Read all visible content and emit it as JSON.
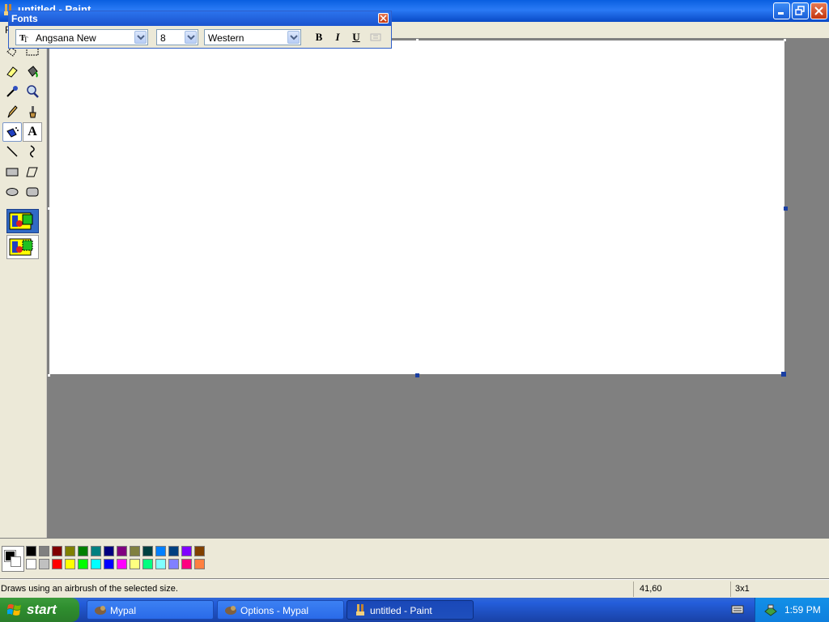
{
  "window": {
    "title": "untitled - Paint",
    "menu_first_letter": "F"
  },
  "fonts_toolbar": {
    "title": "Fonts",
    "font_name": "Angsana New",
    "font_size": "8",
    "script": "Western",
    "bold_label": "B",
    "italic_label": "I",
    "underline_label": "U"
  },
  "toolbox": {
    "tools": [
      "free-form-select-icon",
      "select-icon",
      "eraser-icon",
      "fill-with-color-icon",
      "pick-color-icon",
      "magnifier-icon",
      "pencil-icon",
      "brush-icon",
      "airbrush-icon",
      "text-icon",
      "line-icon",
      "curve-icon",
      "rectangle-icon",
      "polygon-icon",
      "ellipse-icon",
      "rounded-rectangle-icon"
    ],
    "selected_tool": "airbrush-icon",
    "text_tool_label": "A"
  },
  "palette": {
    "foreground": "#000000",
    "background": "#ffffff",
    "row1": [
      "#000000",
      "#808080",
      "#800000",
      "#808000",
      "#008000",
      "#008080",
      "#000080",
      "#800080",
      "#808040",
      "#004040",
      "#0080ff",
      "#004080",
      "#8000ff",
      "#804000"
    ],
    "row2": [
      "#ffffff",
      "#c0c0c0",
      "#ff0000",
      "#ffff00",
      "#00ff00",
      "#00ffff",
      "#0000ff",
      "#ff00ff",
      "#ffff80",
      "#00ff80",
      "#80ffff",
      "#8080ff",
      "#ff0080",
      "#ff8040"
    ]
  },
  "status": {
    "message": "Draws using an airbrush of the selected size.",
    "position": "41,60",
    "size": "3x1"
  },
  "taskbar": {
    "start_label": "start",
    "tasks": [
      {
        "label": "Mypal"
      },
      {
        "label": "Options - Mypal"
      },
      {
        "label": "untitled - Paint"
      }
    ],
    "clock": "1:59 PM"
  }
}
